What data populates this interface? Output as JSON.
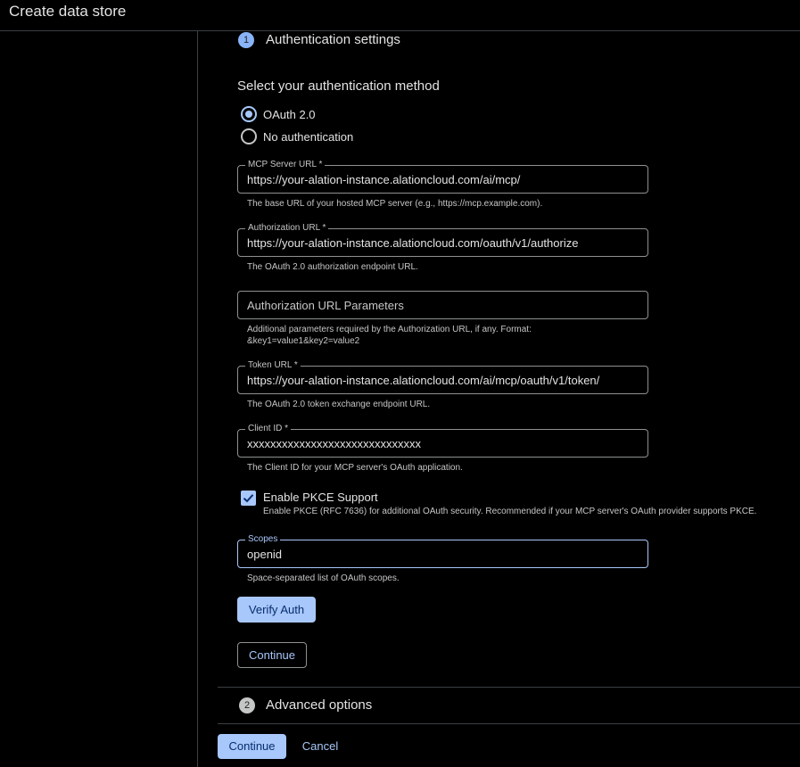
{
  "header": {
    "title": "Create data store"
  },
  "step1": {
    "number": "1",
    "title": "Authentication settings"
  },
  "auth": {
    "section_title": "Select your authentication method",
    "options": [
      {
        "label": "OAuth 2.0",
        "selected": true
      },
      {
        "label": "No authentication",
        "selected": false
      }
    ]
  },
  "fields": {
    "mcp_server_url": {
      "label": "MCP Server URL *",
      "value": "https://your-alation-instance.alationcloud.com/ai/mcp/",
      "hint": "The base URL of your hosted MCP server (e.g., https://mcp.example.com)."
    },
    "authorization_url": {
      "label": "Authorization URL *",
      "value": "https://your-alation-instance.alationcloud.com/oauth/v1/authorize",
      "hint": "The OAuth 2.0 authorization endpoint URL."
    },
    "authorization_url_params": {
      "placeholder": "Authorization URL Parameters",
      "hint_line1": "Additional parameters required by the Authorization URL, if any. Format:",
      "hint_line2": "&key1=value1&key2=value2"
    },
    "token_url": {
      "label": "Token URL *",
      "value": "https://your-alation-instance.alationcloud.com/ai/mcp/oauth/v1/token/",
      "hint": "The OAuth 2.0 token exchange endpoint URL."
    },
    "client_id": {
      "label": "Client ID *",
      "value": "xxxxxxxxxxxxxxxxxxxxxxxxxxxxxx",
      "hint": "The Client ID for your MCP server's OAuth application."
    },
    "scopes": {
      "label": "Scopes",
      "value": "openid",
      "hint": "Space-separated list of OAuth scopes."
    }
  },
  "pkce": {
    "checked": true,
    "label": "Enable PKCE Support",
    "description": "Enable PKCE (RFC 7636) for additional OAuth security. Recommended if your MCP server's OAuth provider supports PKCE."
  },
  "buttons": {
    "verify_auth": "Verify Auth",
    "continue_step": "Continue",
    "continue_main": "Continue",
    "cancel": "Cancel"
  },
  "step2": {
    "number": "2",
    "title": "Advanced options"
  },
  "colors": {
    "accent": "#a8c7fa",
    "background": "#000000",
    "text": "#e3e3e3",
    "muted": "#c4c7c5",
    "border": "#8e918f"
  }
}
